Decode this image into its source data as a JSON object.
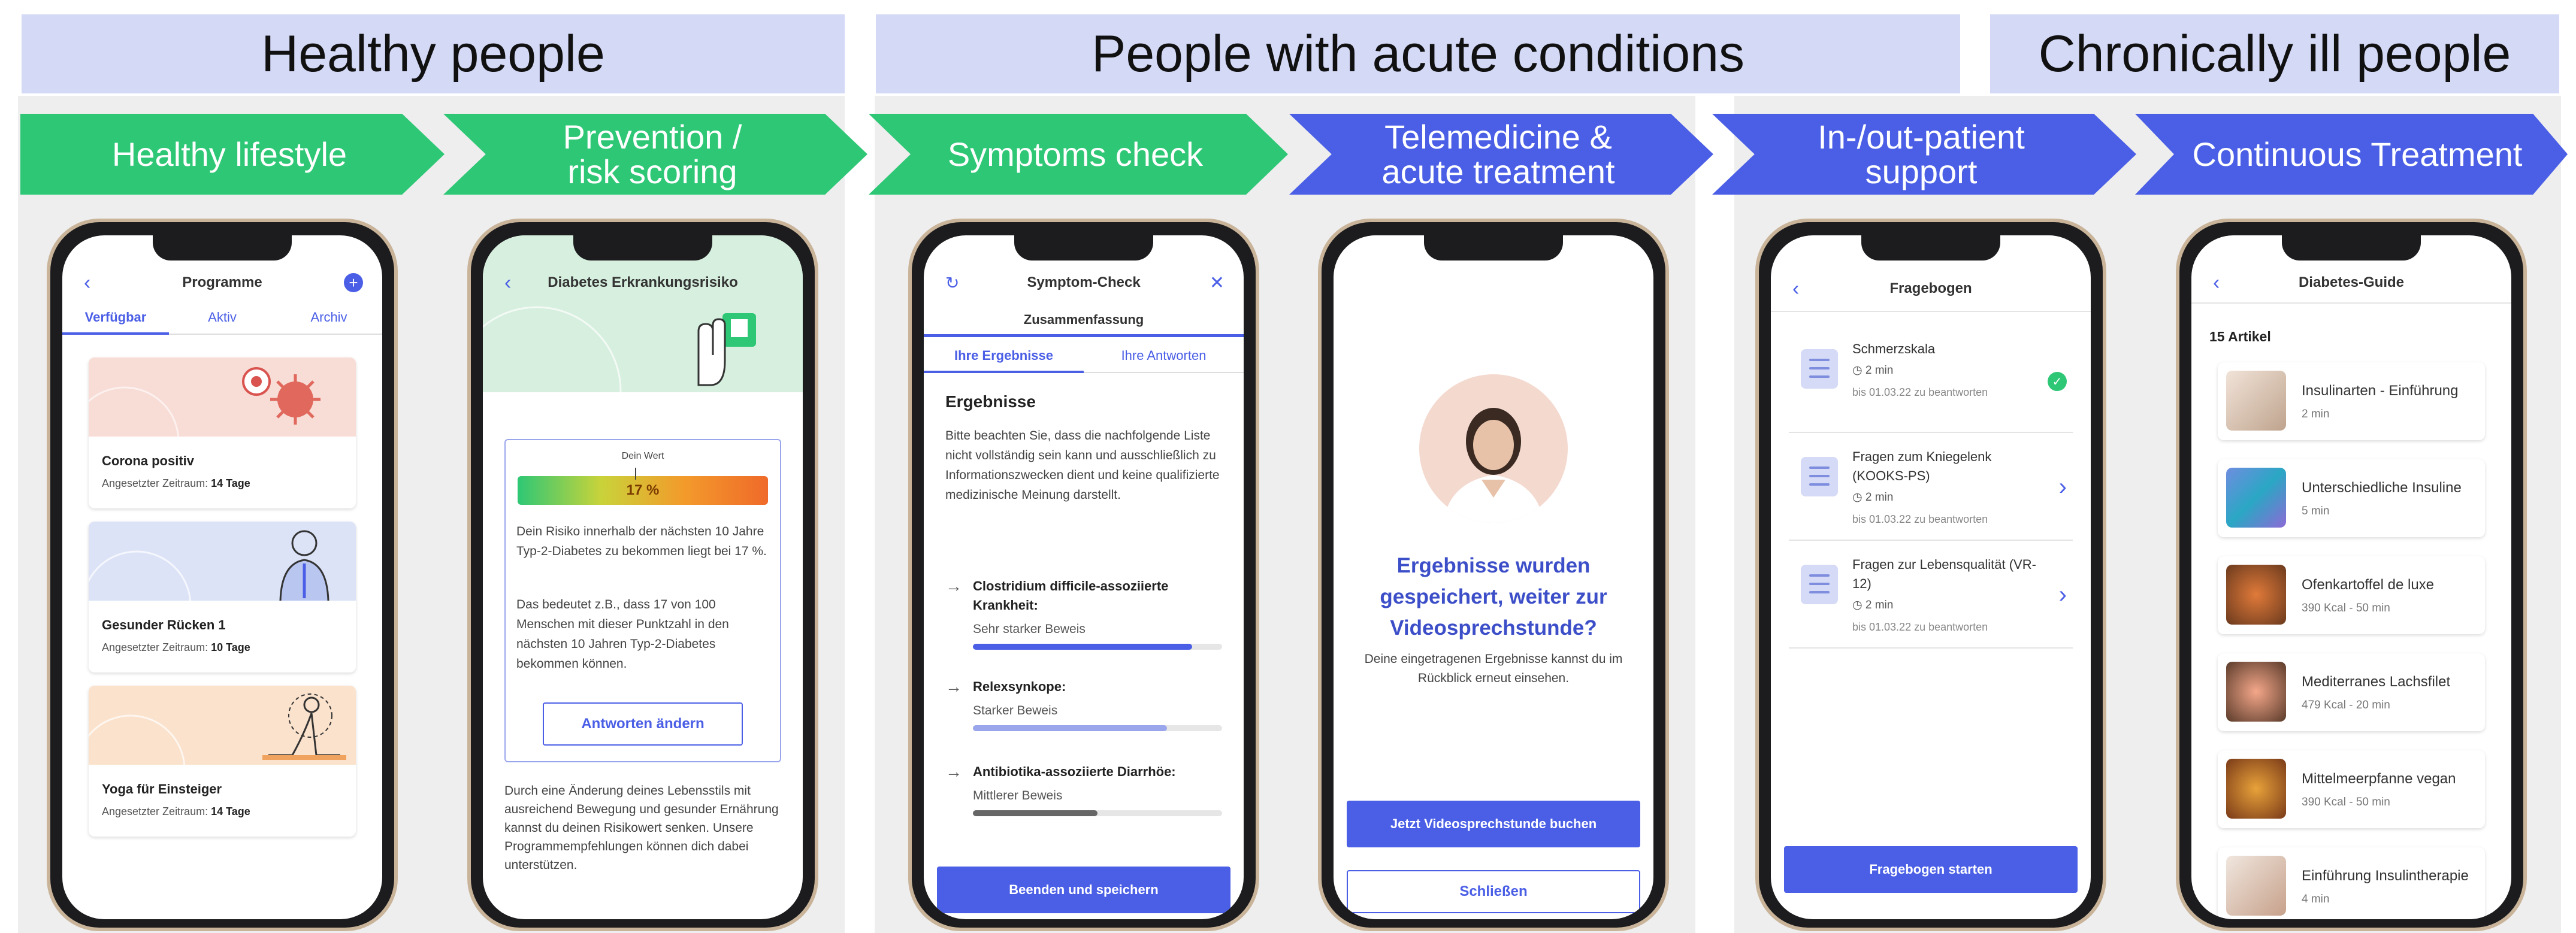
{
  "groups": [
    {
      "title": "Healthy people"
    },
    {
      "title": "People with acute conditions"
    },
    {
      "title": "Chronically ill people"
    }
  ],
  "stages": [
    {
      "label": "Healthy lifestyle"
    },
    {
      "label": "Prevention /\nrisk scoring"
    },
    {
      "label": "Symptoms check"
    },
    {
      "label": "Telemedicine &\nacute treatment"
    },
    {
      "label": "In-/out-patient\nsupport"
    },
    {
      "label": "Continuous Treatment"
    }
  ],
  "colors": {
    "green": "#2ec775",
    "blue": "#4a5ee6",
    "header_bg": "#d4d9f6"
  },
  "phone1": {
    "title": "Programme",
    "tabs": [
      "Verfügbar",
      "Aktiv",
      "Archiv"
    ],
    "cards": [
      {
        "title": "Corona positiv",
        "period_label": "Angesetzter Zeitraum:",
        "period": "14 Tage"
      },
      {
        "title": "Gesunder Rücken 1",
        "period_label": "Angesetzter Zeitraum:",
        "period": "10 Tage"
      },
      {
        "title": "Yoga für Einsteiger",
        "period_label": "Angesetzter Zeitraum:",
        "period": "14 Tage"
      }
    ]
  },
  "phone2": {
    "title": "Diabetes Erkrankungsrisiko",
    "gauge_label": "Dein Wert",
    "gauge_value": "17 %",
    "risk_fraction": 0.17,
    "para1": "Dein Risiko innerhalb der nächsten 10 Jahre Typ-2-Diabetes zu bekommen liegt bei 17 %.",
    "para2": "Das bedeutet z.B., dass 17 von 100 Menschen mit dieser Punktzahl in den nächsten 10 Jahren Typ-2-Diabetes bekommen können.",
    "button": "Antworten ändern",
    "para3": "Durch eine Änderung deines Lebensstils mit ausreichend Bewegung und gesunder Ernährung kannst du deinen Risikowert senken. Unsere Programmempfehlungen können dich dabei unterstützen."
  },
  "phone3": {
    "title": "Symptom-Check",
    "subtitle": "Zusammenfassung",
    "tabs": [
      "Ihre Ergebnisse",
      "Ihre Antworten"
    ],
    "heading": "Ergebnisse",
    "intro": "Bitte beachten Sie, dass die nachfolgende Liste nicht vollständig sein kann und ausschließlich zu Informationszwecken dient und keine qualifizierte medizinische Meinung darstellt.",
    "results": [
      {
        "name": "Clostridium difficile-assoziierte Krankheit:",
        "evidence": "Sehr starker Beweis",
        "strength": 0.88
      },
      {
        "name": "Relexsynkope:",
        "evidence": "Starker Beweis",
        "strength": 0.78
      },
      {
        "name": "Antibiotika-assoziierte Diarrhöe:",
        "evidence": "Mittlerer Beweis",
        "strength": 0.5
      }
    ],
    "button": "Beenden und speichern"
  },
  "phone4": {
    "headline": "Ergebnisse wurden gespeichert, weiter zur Videosprechstunde?",
    "text": "Deine eingetragenen Ergebnisse kannst du im Rückblick erneut einsehen.",
    "primary_button": "Jetzt Videosprechstunde buchen",
    "secondary_button": "Schließen"
  },
  "phone5": {
    "title": "Fragebogen",
    "items": [
      {
        "title": "Schmerzskala",
        "time": "2 min",
        "due": "bis 01.03.22 zu beantworten",
        "status": "done"
      },
      {
        "title": "Fragen zum Kniegelenk (KOOKS-PS)",
        "time": "2 min",
        "due": "bis 01.03.22 zu beantworten",
        "status": "open"
      },
      {
        "title": "Fragen zur Lebensqualität (VR-12)",
        "time": "2 min",
        "due": "bis 01.03.22 zu beantworten",
        "status": "open"
      }
    ],
    "button": "Fragebogen starten"
  },
  "phone6": {
    "title": "Diabetes-Guide",
    "count": "15 Artikel",
    "articles": [
      {
        "title": "Insulinarten - Einführung",
        "meta": "2 min"
      },
      {
        "title": "Unterschiedliche Insuline",
        "meta": "5 min"
      },
      {
        "title": "Ofenkartoffel de luxe",
        "meta": "390 Kcal - 50 min"
      },
      {
        "title": "Mediterranes Lachsfilet",
        "meta": "479 Kcal - 20 min"
      },
      {
        "title": "Mittelmeerpfanne vegan",
        "meta": "390 Kcal - 50 min"
      },
      {
        "title": "Einführung Insulintherapie",
        "meta": "4 min"
      }
    ]
  }
}
